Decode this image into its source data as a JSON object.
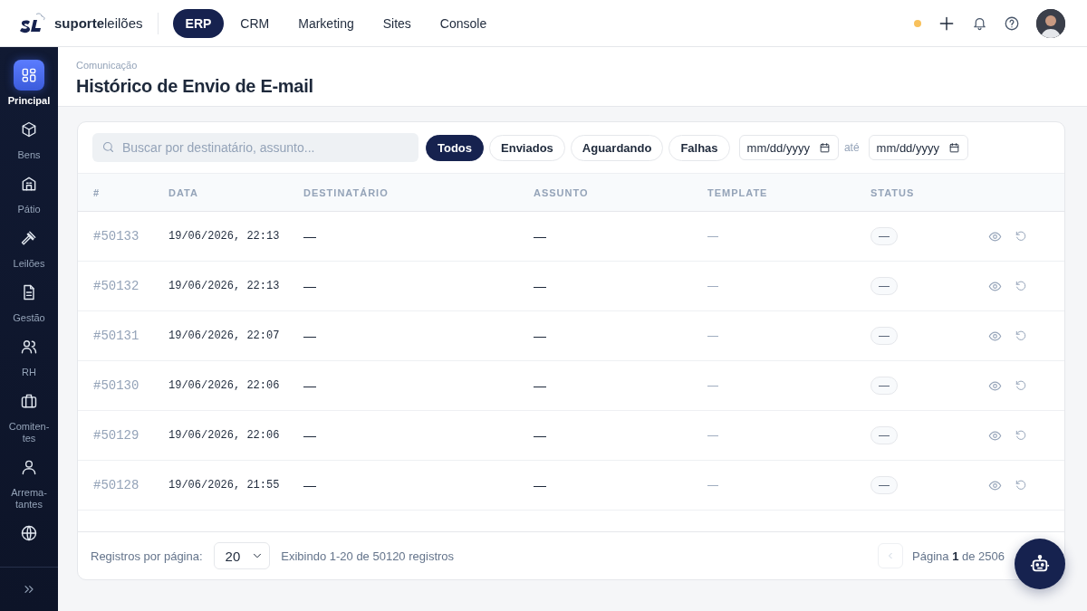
{
  "brand": {
    "name_bold": "suporte",
    "name_light": "leilões"
  },
  "top_nav": [
    {
      "label": "ERP",
      "selected": true
    },
    {
      "label": "CRM",
      "selected": false
    },
    {
      "label": "Marketing",
      "selected": false
    },
    {
      "label": "Sites",
      "selected": false
    },
    {
      "label": "Console",
      "selected": false
    }
  ],
  "sidebar": {
    "items": [
      {
        "label": "Principal",
        "selected": true
      },
      {
        "label": "Bens",
        "selected": false
      },
      {
        "label": "Pátio",
        "selected": false
      },
      {
        "label": "Leilões",
        "selected": false
      },
      {
        "label": "Gestão",
        "selected": false
      },
      {
        "label": "RH",
        "selected": false
      },
      {
        "label": "Comiten-tes",
        "selected": false
      },
      {
        "label": "Arrema-tantes",
        "selected": false
      },
      {
        "selected": false
      }
    ]
  },
  "breadcrumb": "Comunicação",
  "title": "Histórico de Envio de E-mail",
  "search": {
    "placeholder": "Buscar por destinatário, assunto..."
  },
  "filters": [
    {
      "label": "Todos",
      "selected": true
    },
    {
      "label": "Enviados",
      "selected": false
    },
    {
      "label": "Aguardando",
      "selected": false
    },
    {
      "label": "Falhas",
      "selected": false
    }
  ],
  "date_from": {
    "placeholder": "mm/dd/yyyy"
  },
  "date_separator": "até",
  "date_to": {
    "placeholder": "mm/dd/yyyy"
  },
  "table": {
    "columns": [
      "#",
      "DATA",
      "DESTINATÁRIO",
      "ASSUNTO",
      "TEMPLATE",
      "STATUS"
    ],
    "rows": [
      {
        "id": "#50133",
        "date": "19/06/2026, 22:13",
        "recipient": "—",
        "subject": "—",
        "template": "—",
        "status": "—"
      },
      {
        "id": "#50132",
        "date": "19/06/2026, 22:13",
        "recipient": "—",
        "subject": "—",
        "template": "—",
        "status": "—"
      },
      {
        "id": "#50131",
        "date": "19/06/2026, 22:07",
        "recipient": "—",
        "subject": "—",
        "template": "—",
        "status": "—"
      },
      {
        "id": "#50130",
        "date": "19/06/2026, 22:06",
        "recipient": "—",
        "subject": "—",
        "template": "—",
        "status": "—"
      },
      {
        "id": "#50129",
        "date": "19/06/2026, 22:06",
        "recipient": "—",
        "subject": "—",
        "template": "—",
        "status": "—"
      },
      {
        "id": "#50128",
        "date": "19/06/2026, 21:55",
        "recipient": "—",
        "subject": "—",
        "template": "—",
        "status": "—"
      }
    ]
  },
  "footer": {
    "per_page_label": "Registros por página:",
    "per_page": "20",
    "summary": "Exibindo 1-20 de 50120 registros",
    "page_info": "Página **1** de 2506"
  }
}
